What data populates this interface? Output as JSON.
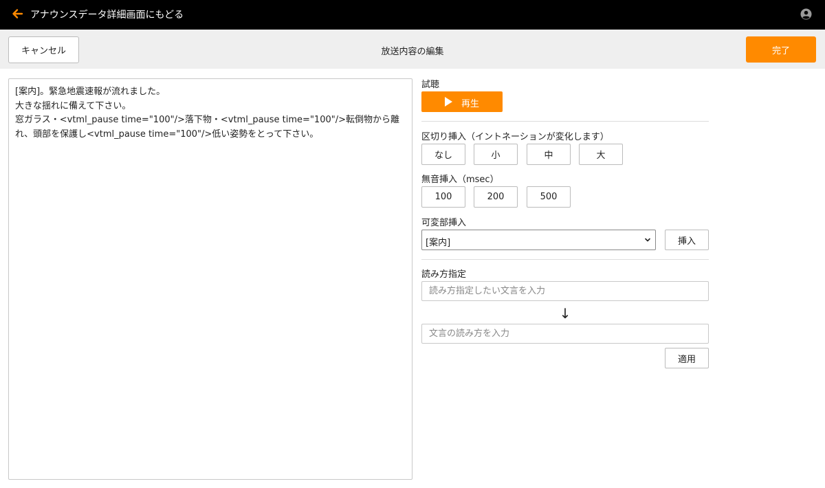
{
  "header": {
    "back_label": "アナウンスデータ詳細画面にもどる",
    "accent_color": "#ff8a00"
  },
  "toolbar": {
    "cancel_label": "キャンセル",
    "title": "放送内容の編集",
    "done_label": "完了"
  },
  "editor": {
    "content": "[案内]。緊急地震速報が流れました。\n大きな揺れに備えて下さい。\n窓ガラス・<vtml_pause time=\"100\"/>落下物・<vtml_pause time=\"100\"/>転倒物から離れ、頭部を保護し<vtml_pause time=\"100\"/>低い姿勢をとって下さい。"
  },
  "preview": {
    "label": "試聴",
    "play_label": "再生"
  },
  "breaks": {
    "label": "区切り挿入（イントネーションが変化します）",
    "options": [
      "なし",
      "小",
      "中",
      "大"
    ]
  },
  "silence": {
    "label": "無音挿入（msec）",
    "options": [
      "100",
      "200",
      "500"
    ]
  },
  "variable": {
    "label": "可変部挿入",
    "selected": "[案内]",
    "insert_label": "挿入"
  },
  "reading": {
    "label": "読み方指定",
    "source_placeholder": "読み方指定したい文言を入力",
    "arrow": "↓",
    "target_placeholder": "文言の読み方を入力",
    "apply_label": "適用"
  }
}
